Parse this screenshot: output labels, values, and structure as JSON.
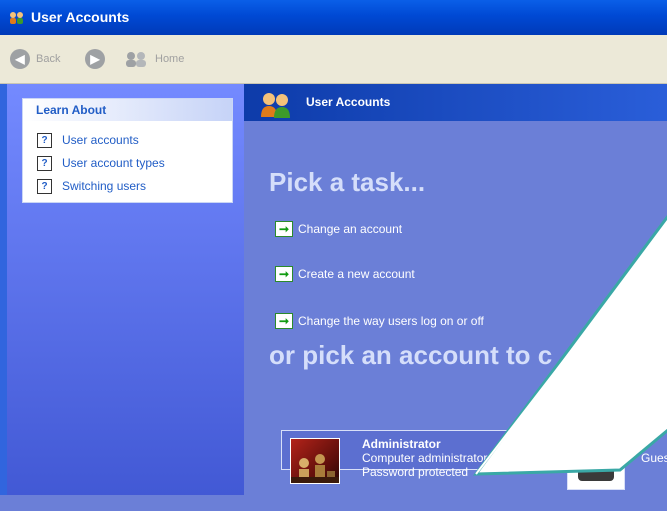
{
  "window": {
    "title": "User Accounts"
  },
  "toolbar": {
    "back_label": "Back",
    "home_label": "Home"
  },
  "learn_about": {
    "heading": "Learn About",
    "items": [
      {
        "label": "User accounts"
      },
      {
        "label": "User account types"
      },
      {
        "label": "Switching users"
      }
    ]
  },
  "main": {
    "header_title": "User Accounts",
    "pick_task_heading": "Pick a task...",
    "tasks": [
      {
        "label": "Change an account"
      },
      {
        "label": "Create a new account"
      },
      {
        "label": "Change the way users log on or off"
      }
    ],
    "pick_account_heading": "or pick an account to c",
    "accounts": [
      {
        "name": "Administrator",
        "type": "Computer administrator",
        "status": "Password protected"
      },
      {
        "name": "Gues"
      }
    ]
  },
  "colors": {
    "accent": "#215dc6",
    "panel_blue": "#6b7fd7",
    "title_blue": "#0049d4",
    "task_green": "#129b12"
  }
}
